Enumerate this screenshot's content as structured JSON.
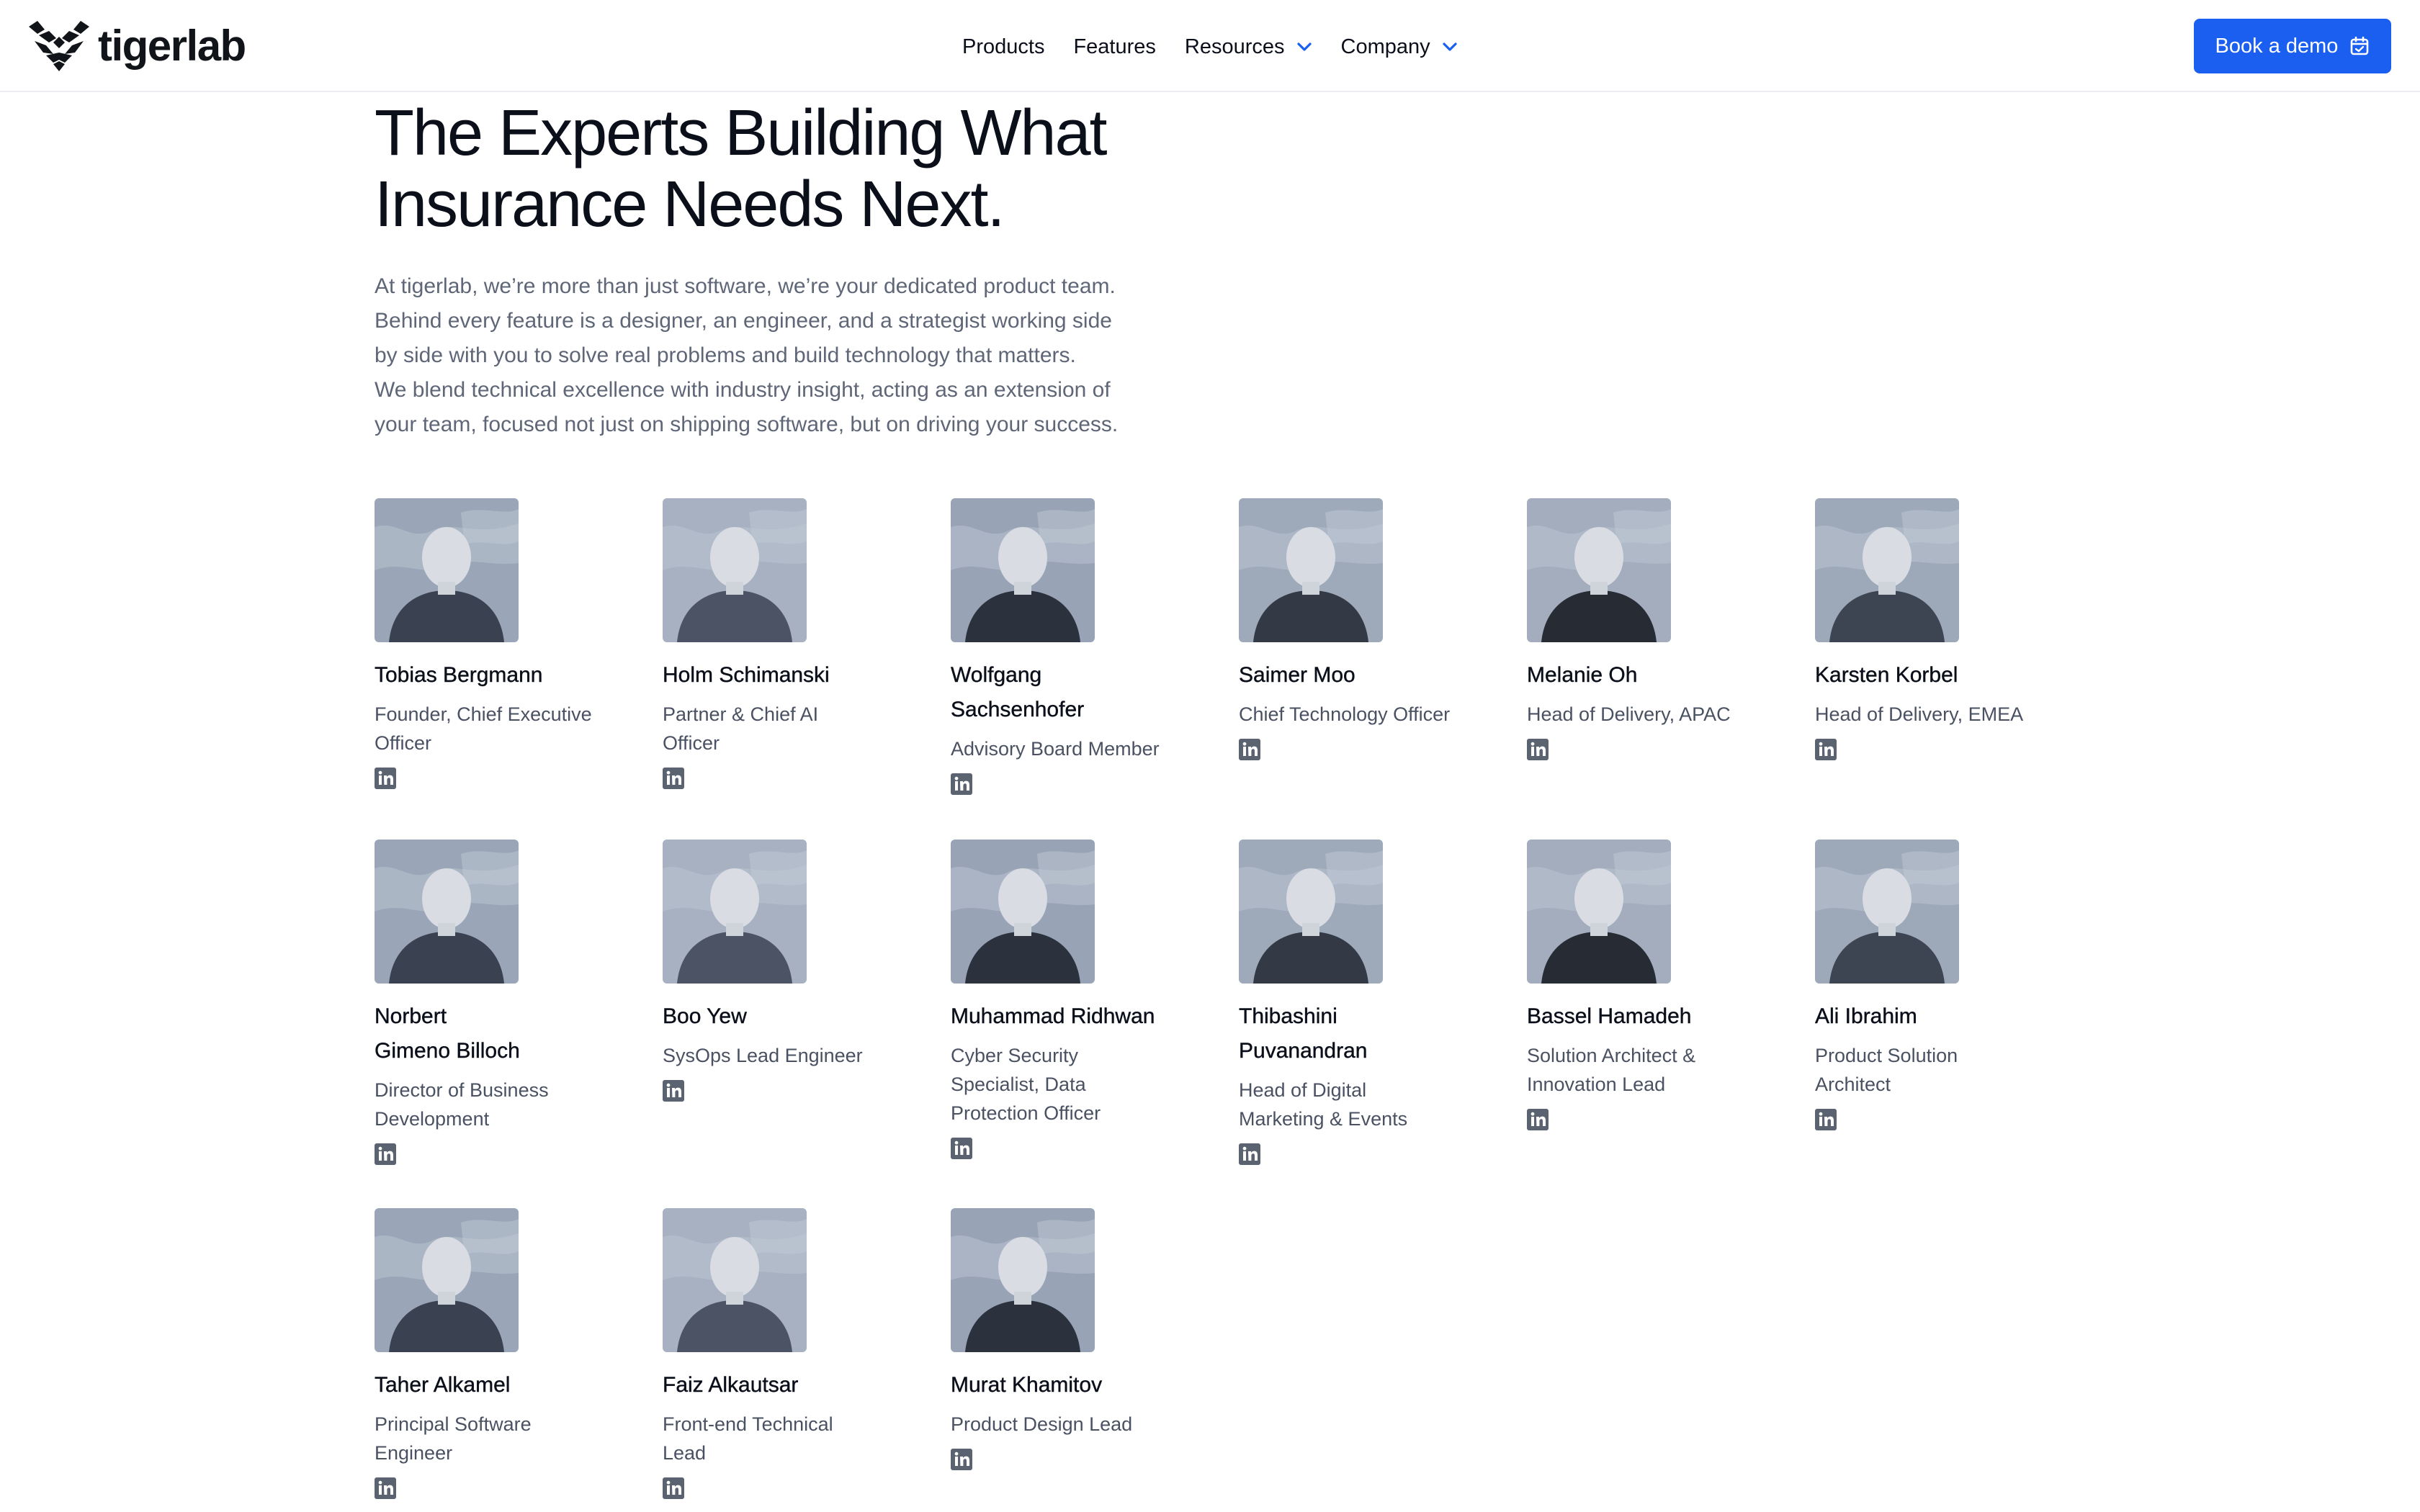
{
  "brand": {
    "name": "tigerlab",
    "accent": "#1a5ff0"
  },
  "nav": {
    "items": [
      {
        "label": "Products",
        "has_dropdown": false
      },
      {
        "label": "Features",
        "has_dropdown": false
      },
      {
        "label": "Resources",
        "has_dropdown": true
      },
      {
        "label": "Company",
        "has_dropdown": true
      }
    ],
    "cta_label": "Book a demo",
    "cta_icon": "calendar-icon"
  },
  "hero": {
    "title_lines": [
      "The Experts Building What",
      "Insurance Needs Next."
    ],
    "intro_lines": [
      "At tigerlab, we’re more than just software, we’re your dedicated product team.",
      "Behind every feature is a designer, an engineer, and a strategist working side",
      "by side with you to solve real problems and build technology that matters.",
      "We blend technical excellence with industry insight, acting as an extension of",
      "your team, focused not just on shipping software, but on driving your success."
    ]
  },
  "team": [
    {
      "name_lines": [
        "Tobias Bergmann"
      ],
      "role_lines": [
        "Founder, Chief Executive",
        "Officer"
      ]
    },
    {
      "name_lines": [
        "Holm Schimanski"
      ],
      "role_lines": [
        "Partner & Chief AI",
        "Officer"
      ]
    },
    {
      "name_lines": [
        "Wolfgang",
        "Sachsenhofer"
      ],
      "role_lines": [
        "Advisory Board Member"
      ]
    },
    {
      "name_lines": [
        "Saimer Moo"
      ],
      "role_lines": [
        "Chief Technology Officer"
      ]
    },
    {
      "name_lines": [
        "Melanie Oh"
      ],
      "role_lines": [
        "Head of Delivery, APAC"
      ]
    },
    {
      "name_lines": [
        "Karsten Korbel"
      ],
      "role_lines": [
        "Head of Delivery, EMEA"
      ]
    },
    {
      "name_lines": [
        "Norbert",
        "Gimeno Billoch"
      ],
      "role_lines": [
        "Director of Business",
        "Development"
      ]
    },
    {
      "name_lines": [
        "Boo Yew"
      ],
      "role_lines": [
        "SysOps Lead Engineer"
      ]
    },
    {
      "name_lines": [
        "Muhammad Ridhwan"
      ],
      "role_lines": [
        "Cyber Security",
        "Specialist, Data",
        "Protection Officer"
      ]
    },
    {
      "name_lines": [
        "Thibashini",
        "Puvanandran"
      ],
      "role_lines": [
        "Head of Digital",
        "Marketing & Events"
      ]
    },
    {
      "name_lines": [
        "Bassel Hamadeh"
      ],
      "role_lines": [
        "Solution Architect &",
        "Innovation Lead"
      ]
    },
    {
      "name_lines": [
        "Ali Ibrahim"
      ],
      "role_lines": [
        "Product Solution",
        "Architect"
      ]
    },
    {
      "name_lines": [
        "Taher Alkamel"
      ],
      "role_lines": [
        "Principal Software",
        "Engineer"
      ]
    },
    {
      "name_lines": [
        "Faiz Alkautsar"
      ],
      "role_lines": [
        "Front-end Technical",
        "Lead"
      ]
    },
    {
      "name_lines": [
        "Murat Khamitov"
      ],
      "role_lines": [
        "Product Design Lead"
      ]
    }
  ]
}
